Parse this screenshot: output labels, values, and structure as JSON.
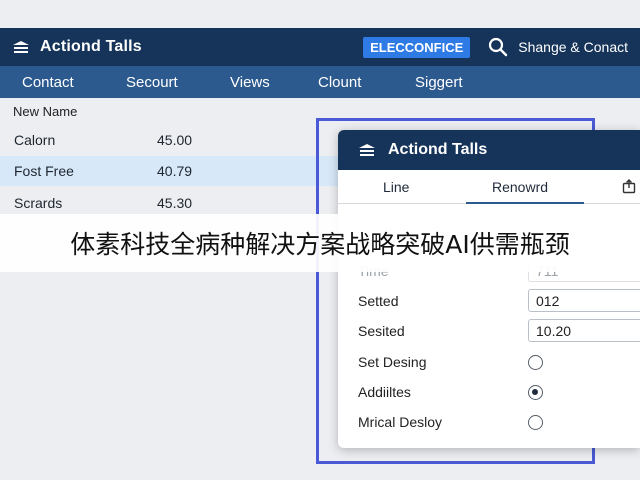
{
  "header": {
    "title": "Actiond Talls",
    "badge": "ELECCONFICE",
    "search_label": "Shange & Conact"
  },
  "nav": {
    "items": [
      "Contact",
      "Secourt",
      "Views",
      "Clount",
      "Siggert"
    ]
  },
  "list": {
    "header": "New Name",
    "rows": [
      {
        "name": "Calorn",
        "value": "45.00"
      },
      {
        "name": "Fost Free",
        "value": "40.79"
      },
      {
        "name": "Scrards",
        "value": "45.30"
      }
    ]
  },
  "dialog": {
    "title": "Actiond Talls",
    "tabs": [
      "Line",
      "Renowrd"
    ],
    "fields": [
      {
        "label": "Time",
        "value": "711"
      },
      {
        "label": "Setted",
        "value": "012"
      },
      {
        "label": "Sesited",
        "value": "10.20"
      }
    ],
    "options": [
      {
        "label": "Set Desing",
        "checked": false
      },
      {
        "label": "Addiiltes",
        "checked": true
      },
      {
        "label": "Mrical Desloy",
        "checked": false
      }
    ]
  },
  "caption": "体素科技全病种解决方案战略突破AI供需瓶颈",
  "colors": {
    "header_bg": "#16345a",
    "nav_bg": "#2c5a8f",
    "badge_bg": "#2f7be6",
    "selected_row": "#d7e8f8",
    "frame": "#4a5ad6"
  }
}
